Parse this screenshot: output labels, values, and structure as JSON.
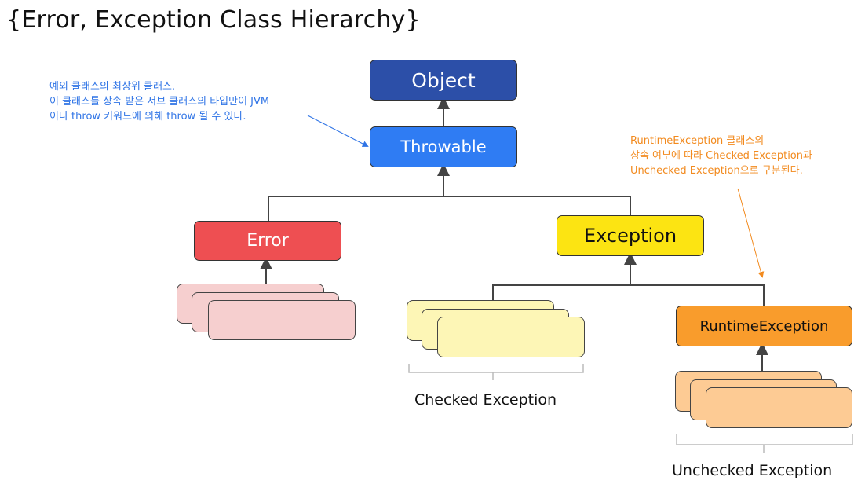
{
  "title": "{Error, Exception Class Hierarchy}",
  "nodes": {
    "object": "Object",
    "throwable": "Throwable",
    "error": "Error",
    "exception": "Exception",
    "runtime_exception": "RuntimeException"
  },
  "notes": {
    "throwable_note": [
      "예외 클래스의 최상위 클래스.",
      "이 클래스를 상속 받은 서브 클래스의 타입만이 JVM",
      "이나 throw 키워드에 의해 throw 될 수 있다."
    ],
    "runtime_note": [
      "RuntimeException 클래스의",
      "상속 여부에 따라 Checked Exception과",
      "Unchecked Exception으로 구분된다."
    ]
  },
  "captions": {
    "checked": "Checked Exception",
    "unchecked": "Unchecked Exception"
  },
  "colors": {
    "object": "#2c4fa8",
    "throwable": "#2f7cf3",
    "error": "#ee4f52",
    "exception": "#fce412",
    "runtime_exception": "#f99c2c",
    "error_subclasses": "#f6cfcf",
    "checked_subclasses": "#fdf6b6",
    "unchecked_subclasses": "#fdcb94",
    "note_blue": "#2f74e6",
    "note_orange": "#f28a1e"
  }
}
